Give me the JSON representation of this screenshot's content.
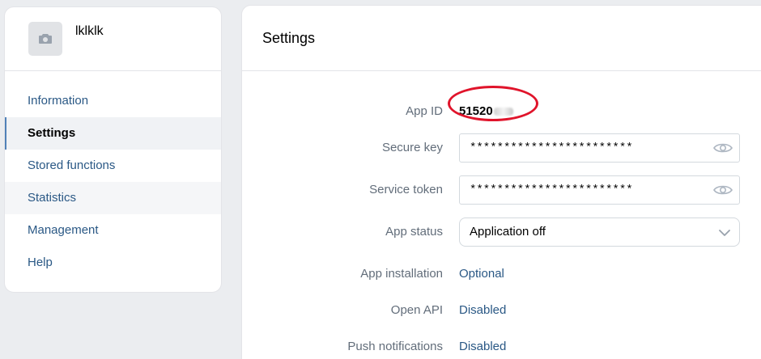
{
  "app": {
    "name": "lklklk",
    "avatar_icon": "camera-icon"
  },
  "nav": {
    "items": [
      {
        "label": "Information"
      },
      {
        "label": "Settings"
      },
      {
        "label": "Stored functions"
      },
      {
        "label": "Statistics"
      },
      {
        "label": "Management"
      },
      {
        "label": "Help"
      }
    ],
    "active": "Settings"
  },
  "settings": {
    "title": "Settings",
    "app_id": {
      "label": "App ID",
      "value": "51520"
    },
    "secure_key": {
      "label": "Secure key",
      "value": "************************",
      "icon": "eye-icon"
    },
    "service_token": {
      "label": "Service token",
      "value": "************************",
      "icon": "eye-icon"
    },
    "app_status": {
      "label": "App status",
      "value": "Application off",
      "icon": "chevron-down-icon"
    },
    "app_installation": {
      "label": "App installation",
      "value": "Optional"
    },
    "open_api": {
      "label": "Open API",
      "value": "Disabled"
    },
    "push_notifications": {
      "label": "Push notifications",
      "value": "Disabled"
    }
  },
  "colors": {
    "link": "#2a5885",
    "label": "#626d7a",
    "annotation": "#e0142b",
    "background": "#ebedf0"
  }
}
